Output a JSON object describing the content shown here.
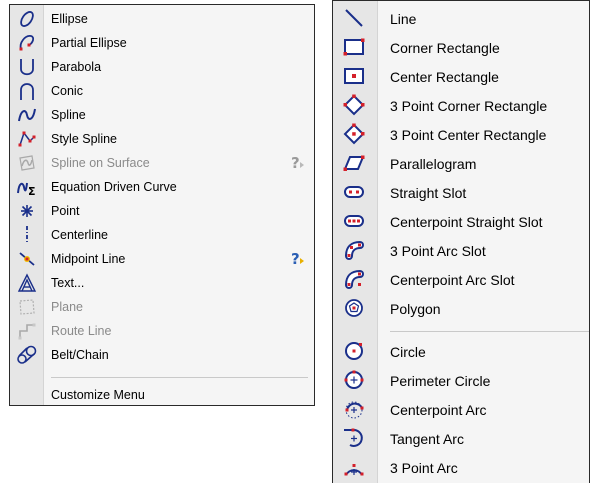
{
  "left_menu": {
    "items": [
      {
        "label": "Ellipse",
        "icon": "ellipse-icon",
        "enabled": true
      },
      {
        "label": "Partial Ellipse",
        "icon": "partial-ellipse-icon",
        "enabled": true
      },
      {
        "label": "Parabola",
        "icon": "parabola-icon",
        "enabled": true
      },
      {
        "label": "Conic",
        "icon": "conic-icon",
        "enabled": true
      },
      {
        "label": "Spline",
        "icon": "spline-icon",
        "enabled": true
      },
      {
        "label": "Style Spline",
        "icon": "style-spline-icon",
        "enabled": true
      },
      {
        "label": "Spline on Surface",
        "icon": "spline-on-surface-icon",
        "enabled": false
      },
      {
        "label": "Equation Driven Curve",
        "icon": "equation-driven-curve-icon",
        "enabled": true
      },
      {
        "label": "Point",
        "icon": "point-icon",
        "enabled": true
      },
      {
        "label": "Centerline",
        "icon": "centerline-icon",
        "enabled": true
      },
      {
        "label": "Midpoint Line",
        "icon": "midpoint-line-icon",
        "enabled": true
      },
      {
        "label": "Text...",
        "icon": "text-icon",
        "enabled": true
      },
      {
        "label": "Plane",
        "icon": "plane-icon",
        "enabled": false
      },
      {
        "label": "Route Line",
        "icon": "route-line-icon",
        "enabled": false
      },
      {
        "label": "Belt/Chain",
        "icon": "belt-chain-icon",
        "enabled": true
      }
    ],
    "footer_item": {
      "label": "Customize Menu"
    }
  },
  "right_menu": {
    "items": [
      {
        "label": "Line",
        "icon": "line-icon"
      },
      {
        "label": "Corner Rectangle",
        "icon": "corner-rectangle-icon"
      },
      {
        "label": "Center Rectangle",
        "icon": "center-rectangle-icon"
      },
      {
        "label": "3 Point Corner Rectangle",
        "icon": "three-point-corner-rectangle-icon"
      },
      {
        "label": "3 Point Center Rectangle",
        "icon": "three-point-center-rectangle-icon"
      },
      {
        "label": "Parallelogram",
        "icon": "parallelogram-icon"
      },
      {
        "label": "Straight Slot",
        "icon": "straight-slot-icon"
      },
      {
        "label": "Centerpoint Straight Slot",
        "icon": "centerpoint-straight-slot-icon"
      },
      {
        "label": "3 Point Arc Slot",
        "icon": "three-point-arc-slot-icon"
      },
      {
        "label": "Centerpoint Arc Slot",
        "icon": "centerpoint-arc-slot-icon"
      },
      {
        "label": "Polygon",
        "icon": "polygon-icon"
      },
      {
        "label": "Circle",
        "icon": "circle-icon"
      },
      {
        "label": "Perimeter Circle",
        "icon": "perimeter-circle-icon"
      },
      {
        "label": "Centerpoint Arc",
        "icon": "centerpoint-arc-icon"
      },
      {
        "label": "Tangent Arc",
        "icon": "tangent-arc-icon"
      },
      {
        "label": "3 Point Arc",
        "icon": "three-point-arc-icon"
      }
    ]
  },
  "colors": {
    "icon_blue": "#1a2f8a",
    "icon_red": "#d4202a",
    "disabled_text": "#8a8a8a",
    "help_yellow": "#e8b000"
  }
}
